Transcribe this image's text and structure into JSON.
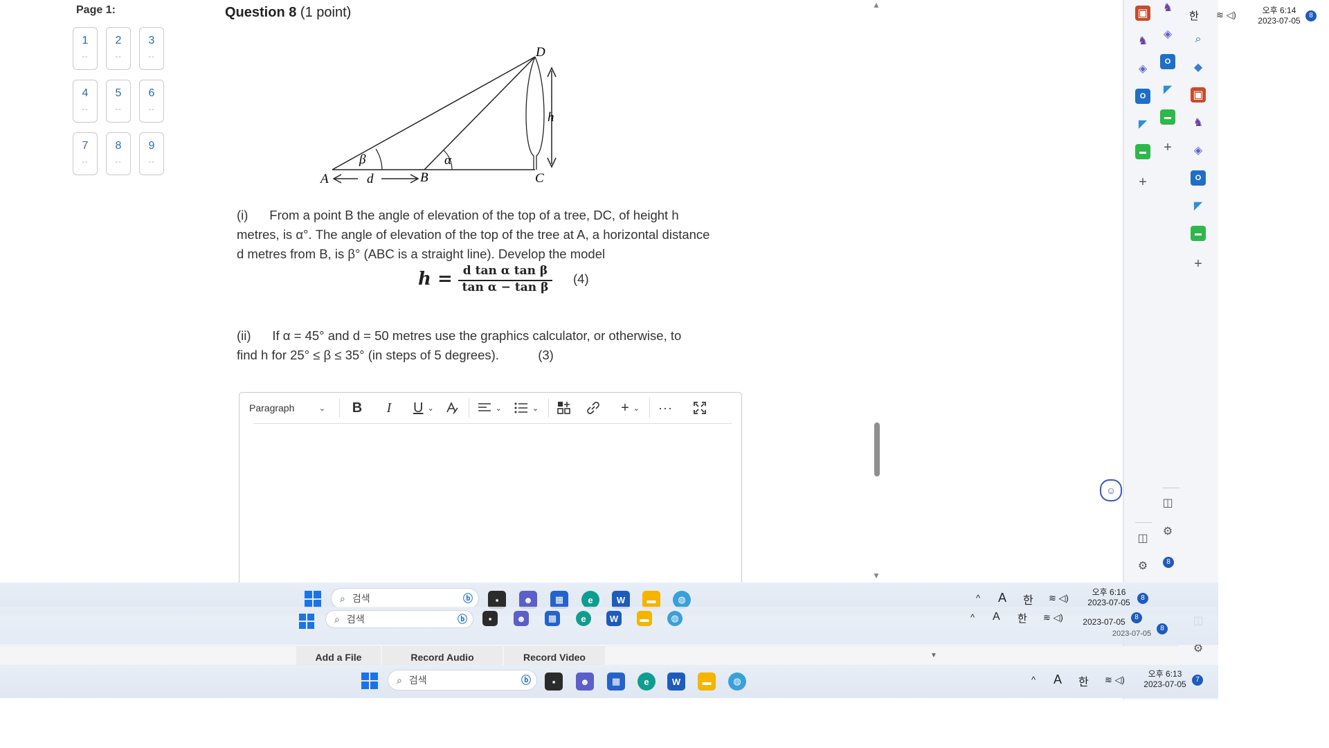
{
  "page": {
    "page_label": "Page 1:",
    "question_buttons": [
      {
        "num": "1",
        "status": "--"
      },
      {
        "num": "2",
        "status": "--"
      },
      {
        "num": "3",
        "status": "--"
      },
      {
        "num": "4",
        "status": "--"
      },
      {
        "num": "5",
        "status": "--"
      },
      {
        "num": "6",
        "status": "--"
      },
      {
        "num": "7",
        "status": "--"
      },
      {
        "num": "8",
        "status": "--"
      },
      {
        "num": "9",
        "status": "--"
      }
    ]
  },
  "question": {
    "title": "Question 8",
    "points": "(1 point)",
    "diagram_labels": {
      "A": "A",
      "B": "B",
      "C": "C",
      "D": "D",
      "h": "h",
      "d": "d",
      "alpha": "α",
      "beta": "β"
    },
    "part_i_label": "(i)",
    "part_i_line1": "From a point B the angle of elevation of the top of a tree, DC, of height h",
    "part_i_line2": "metres, is α°. The angle of elevation of the top of the tree at A, a horizontal distance",
    "part_i_line3": "d metres from B, is β° (ABC is a straight line). Develop the model",
    "formula_lhs": "h =",
    "formula_num": "d tan α tan β",
    "formula_den": "tan α − tan β",
    "part_i_marks": "(4)",
    "part_ii_label": "(ii)",
    "part_ii_line1": "If α = 45° and d = 50 metres use the graphics calculator, or otherwise, to",
    "part_ii_line2": "find h for 25° ≤ β ≤ 35° (in steps of 5 degrees).",
    "part_ii_marks": "(3)"
  },
  "editor": {
    "paragraph_label": "Paragraph",
    "bold": "B",
    "italic": "I",
    "underline": "U"
  },
  "attachments": {
    "add_file": "Add a File",
    "record_audio": "Record Audio",
    "record_video": "Record Video"
  },
  "taskbars": [
    {
      "search": "검색",
      "time": "오후 6:16",
      "date": "2023-07-05",
      "badge": "8"
    },
    {
      "search": "검색",
      "time": "",
      "date": "2023-07-05",
      "badge": "8"
    },
    {
      "search": "검색",
      "time": "오후 6:13",
      "date": "2023-07-05",
      "badge": "7"
    }
  ],
  "top_tray": {
    "time": "오후 6:14",
    "date": "2023-07-05",
    "badge": "8",
    "lang": "한"
  },
  "tray": {
    "lang": "한",
    "ime": "A"
  },
  "overlay_badges": {
    "side_bottom": "8",
    "side_lower": "8",
    "stray_date": "2023-07-05"
  },
  "colors": {
    "accent": "#2a6bb0",
    "taskbar": "#e4ebf4",
    "sidepanel": "#f3f5f8"
  }
}
